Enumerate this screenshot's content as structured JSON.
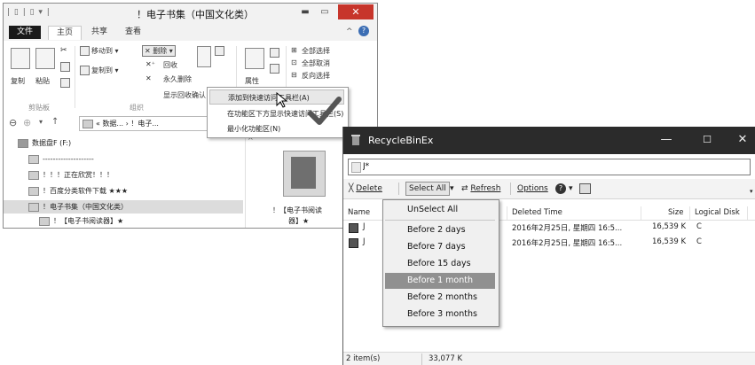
{
  "explorer": {
    "title": "！电子书集（中国文化类）",
    "qat": "| ▯ | ▯ ▾ |",
    "tabs": [
      "文件",
      "主页",
      "共享",
      "查看"
    ],
    "ribbon": {
      "copy": "复制",
      "paste": "粘贴",
      "move_to": "移动到 ▾",
      "copy_to": "复制到 ▾",
      "delete": "删除 ▾",
      "recycle": "回收",
      "perm_delete": "永久删除",
      "show_confirm": "显示回收确认",
      "properties": "属性",
      "select_all": "全部选择",
      "select_none": "全部取消",
      "invert": "反向选择",
      "group_clipboard": "剪贴板",
      "group_organize": "组织"
    },
    "menu": [
      "添加到快速访问工具栏(A)",
      "在功能区下方显示快速访问工具栏(S)",
      "最小化功能区(N)"
    ],
    "address": "« 数据... › ！电子...",
    "tree": [
      "数据盘F (F:)",
      "--------------------",
      "！！！正在欣赏！！！",
      "！百度分类软件下载 ★★★",
      "！电子书集（中国文化类）",
      "！【电子书阅读器】★"
    ],
    "folder_label_1": "！【电子书阅读",
    "folder_label_2": "器】★"
  },
  "recyclebin": {
    "title": "RecycleBinEx",
    "search_value": "J*",
    "toolbar": {
      "delete": "Delete",
      "select_all": "Select All",
      "refresh": "Refresh",
      "options": "Options"
    },
    "columns": [
      "Name",
      "Deleted Time",
      "Size",
      "Logical Disk"
    ],
    "rows": [
      {
        "name": "J",
        "deleted": "2016年2月25日, 星期四 16:5...",
        "size": "16,539 K",
        "disk": "C"
      },
      {
        "name": "J",
        "deleted": "2016年2月25日, 星期四 16:5...",
        "size": "16,539 K",
        "disk": "C"
      }
    ],
    "menu": [
      "UnSelect All",
      "Before 2 days",
      "Before 7 days",
      "Before 15 days",
      "Before 1 month",
      "Before 2 months",
      "Before 3 months"
    ],
    "status_items": "2 item(s)",
    "status_size": "33,077 K"
  },
  "colors": {
    "title_dark": "#2b2b2b",
    "close_red": "#c7352b",
    "menu_highlight": "#909090"
  }
}
